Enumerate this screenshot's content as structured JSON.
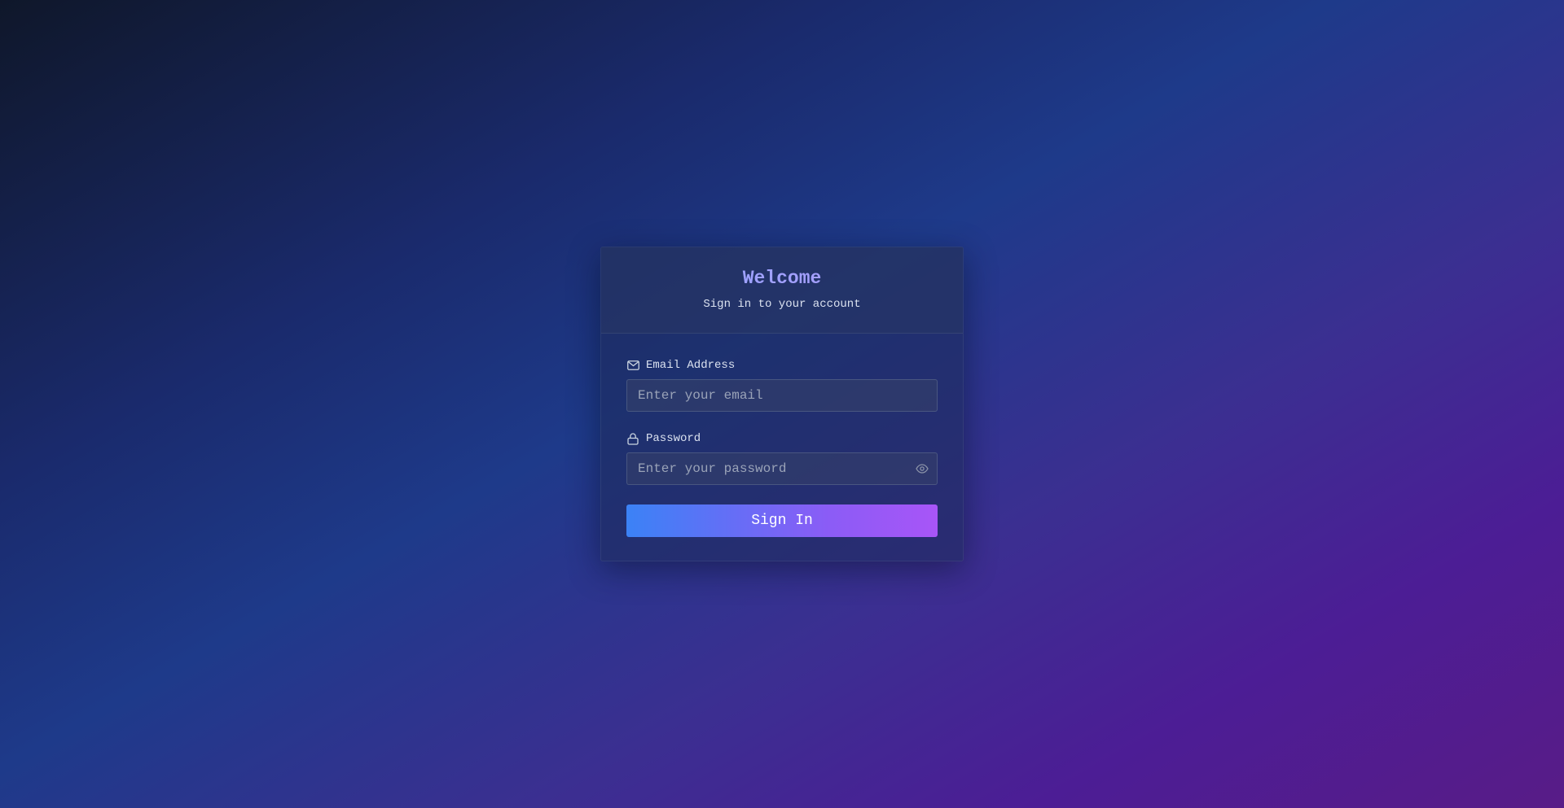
{
  "header": {
    "title": "Welcome",
    "subtitle": "Sign in to your account"
  },
  "form": {
    "email": {
      "label": "Email Address",
      "placeholder": "Enter your email",
      "value": "",
      "icon": "mail-icon"
    },
    "password": {
      "label": "Password",
      "placeholder": "Enter your password",
      "value": "",
      "icon": "lock-icon",
      "toggle_icon": "eye-icon"
    },
    "submit_label": "Sign In"
  },
  "colors": {
    "title_accent": "#a5a0ff",
    "button_gradient_start": "#3b82f6",
    "button_gradient_end": "#a855f7"
  }
}
